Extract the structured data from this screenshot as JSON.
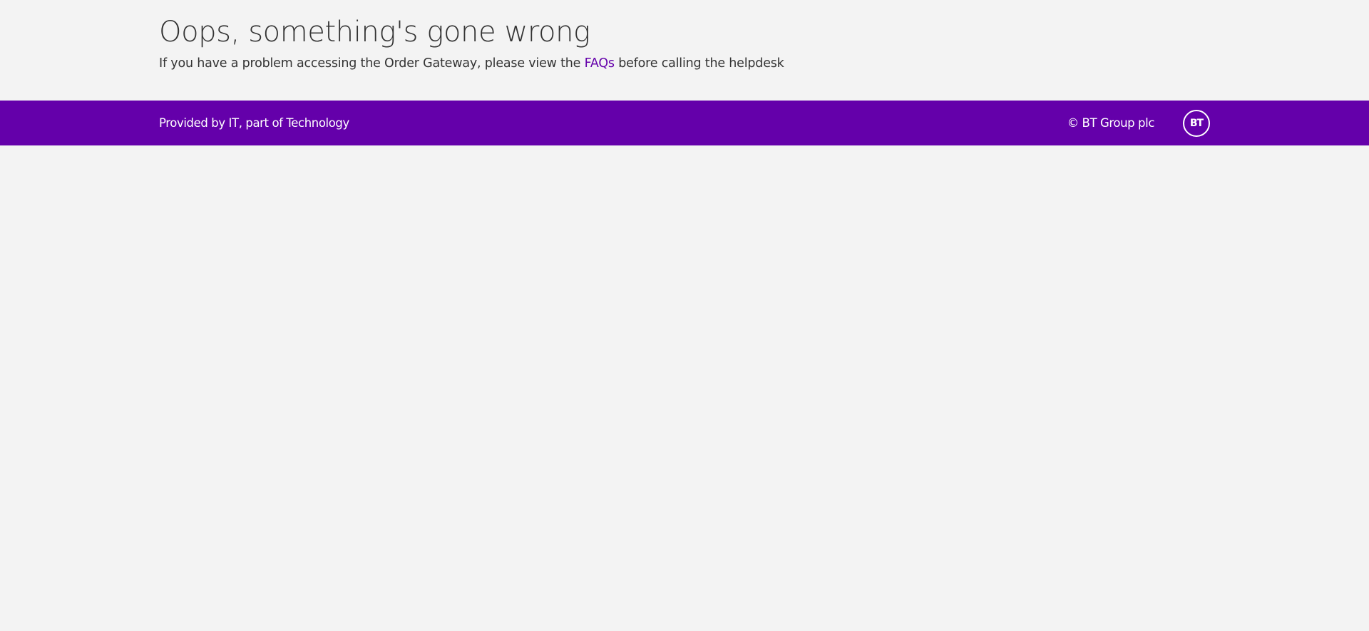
{
  "error": {
    "title": "Oops, something's gone wrong",
    "message_before": "If you have a problem accessing the Order Gateway, please view the ",
    "faqs_link": "FAQs",
    "message_after": " before calling the helpdesk"
  },
  "footer": {
    "provided_by": "Provided by IT, part of Technology",
    "copyright": "© BT Group plc",
    "logo_text": "BT",
    "logo_icon": "bt-logo-icon"
  },
  "colors": {
    "background": "#f3f3f3",
    "footer_background": "#6400aa",
    "link": "#6400aa",
    "text": "#333333",
    "footer_text": "#ffffff"
  }
}
